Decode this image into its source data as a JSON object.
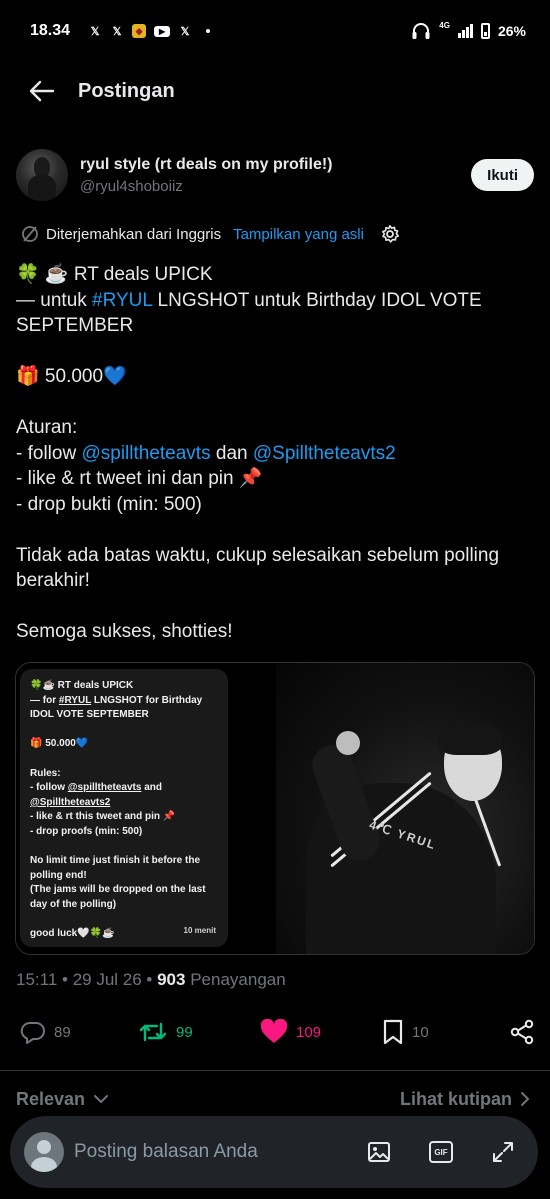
{
  "status_bar": {
    "time": "18.34",
    "notification_icons": [
      "x-icon",
      "x-icon",
      "app-icon",
      "youtube-icon",
      "x-icon"
    ],
    "network": "4G",
    "battery": "26%"
  },
  "header": {
    "title": "Postingan"
  },
  "author": {
    "name": "ryul style (rt deals on my profile!)",
    "handle": "@ryul4shoboiiz",
    "follow_label": "Ikuti"
  },
  "translation": {
    "label": "Diterjemahkan dari Inggris",
    "show_original": "Tampilkan yang asli"
  },
  "tweet": {
    "line1": "🍀 ☕ RT deals UPICK",
    "line2_prefix": "— untuk ",
    "line2_hashtag": "#RYUL",
    "line2_suffix": " LNGSHOT untuk Birthday IDOL VOTE SEPTEMBER",
    "prize": "🎁 50.000💙",
    "rules_title": "Aturan:",
    "rule1_prefix": "- follow ",
    "rule1_mention1": "@spilltheteavts",
    "rule1_mid": " dan ",
    "rule1_mention2": "@Spilltheteavts2",
    "rule2": "- like & rt tweet ini dan pin 📌",
    "rule3": "- drop bukti (min: 500)",
    "note": "Tidak ada batas waktu, cukup selesaikan sebelum polling berakhir!",
    "closing": "Semoga sukses, shotties!"
  },
  "media": {
    "card": {
      "line1": "🍀☕ RT deals  UPICK",
      "line2_prefix": "— for ",
      "line2_hashtag": "#RYUL",
      "line2_suffix": " LNGSHOT for Birthday IDOL VOTE SEPTEMBER",
      "prize": "🎁 50.000💙",
      "rules_title": "Rules:",
      "rule1_prefix": "- follow ",
      "rule1_mention1": "@spilltheteavts",
      "rule1_mid": " and",
      "rule1_mention2": "@Spilltheteavts2",
      "rule2": "- like & rt this tweet and pin 📌",
      "rule3": "- drop proofs (min: 500)",
      "note1": "No limit time just finish it before the polling end!",
      "note2": "(The jams will be dropped on the last day of the polling)",
      "closing": "good luck🤍🍀☕",
      "time": "10 menit"
    },
    "photo_text": "4℃ YRUL"
  },
  "meta": {
    "time": "15:11",
    "date": "29 Jul 26",
    "views": "903",
    "views_label": "Penayangan"
  },
  "actions": {
    "replies": "89",
    "retweets": "99",
    "likes": "109",
    "bookmarks": "10"
  },
  "sort": {
    "label": "Relevan",
    "quotes_label": "Lihat kutipan"
  },
  "composer": {
    "placeholder": "Posting balasan Anda"
  },
  "colors": {
    "background": "#000000",
    "link": "#1d9bf0",
    "retweet_active": "#00ba7c",
    "like_active": "#f91880",
    "muted": "#71767b"
  }
}
